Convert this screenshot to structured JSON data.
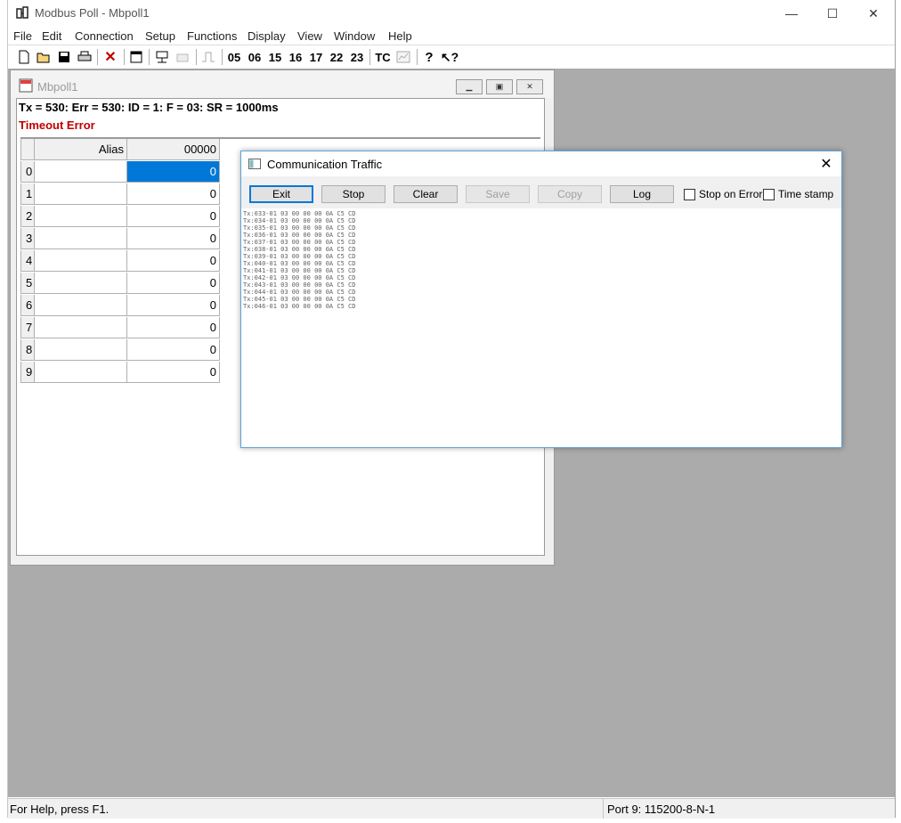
{
  "window": {
    "title": "Modbus Poll - Mbpoll1",
    "controls": {
      "minimize": "—",
      "maximize": "☐",
      "close": "✕"
    }
  },
  "menu": [
    "File",
    "Edit",
    "Connection",
    "Setup",
    "Functions",
    "Display",
    "View",
    "Window",
    "Help"
  ],
  "toolbar": {
    "function_codes": [
      "05",
      "06",
      "15",
      "16",
      "17",
      "22",
      "23"
    ],
    "tc_label": "TC",
    "icons": [
      "new-icon",
      "open-icon",
      "save-icon",
      "print-icon",
      "delete-icon",
      "window-icon",
      "read-icon",
      "write-icon",
      "pulse-icon",
      "chart-icon",
      "help-icon",
      "context-help-icon"
    ]
  },
  "child": {
    "title": "Mbpoll1",
    "status_line": "Tx = 530: Err = 530: ID = 1: F = 03: SR = 1000ms",
    "error_line": "Timeout Error",
    "columns": {
      "alias": "Alias",
      "address": "00000"
    },
    "rows": [
      {
        "num": "0",
        "value": "0"
      },
      {
        "num": "1",
        "value": "0"
      },
      {
        "num": "2",
        "value": "0"
      },
      {
        "num": "3",
        "value": "0"
      },
      {
        "num": "4",
        "value": "0"
      },
      {
        "num": "5",
        "value": "0"
      },
      {
        "num": "6",
        "value": "0"
      },
      {
        "num": "7",
        "value": "0"
      },
      {
        "num": "8",
        "value": "0"
      },
      {
        "num": "9",
        "value": "0"
      }
    ]
  },
  "dialog": {
    "title": "Communication Traffic",
    "buttons": {
      "exit": "Exit",
      "stop": "Stop",
      "clear": "Clear",
      "save": "Save",
      "copy": "Copy",
      "log": "Log"
    },
    "checkboxes": {
      "stop_on_error": "Stop on Error",
      "time_stamp": "Time stamp"
    },
    "traffic": [
      "Tx:033-01 03 00 00 00 0A C5 CD",
      "Tx:034-01 03 00 00 00 0A C5 CD",
      "Tx:035-01 03 00 00 00 0A C5 CD",
      "Tx:036-01 03 00 00 00 0A C5 CD",
      "Tx:037-01 03 00 00 00 0A C5 CD",
      "Tx:038-01 03 00 00 00 0A C5 CD",
      "Tx:039-01 03 00 00 00 0A C5 CD",
      "Tx:040-01 03 00 00 00 0A C5 CD",
      "Tx:041-01 03 00 00 00 0A C5 CD",
      "Tx:042-01 03 00 00 00 0A C5 CD",
      "Tx:043-01 03 00 00 00 0A C5 CD",
      "Tx:044-01 03 00 00 00 0A C5 CD",
      "Tx:045-01 03 00 00 00 0A C5 CD",
      "Tx:046-01 03 00 00 00 0A C5 CD"
    ]
  },
  "statusbar": {
    "help": "For Help, press F1.",
    "port": "Port 9: 115200-8-N-1"
  },
  "colors": {
    "selection": "#0078d7",
    "error_text": "#c00000",
    "mdi_background": "#ababab"
  }
}
